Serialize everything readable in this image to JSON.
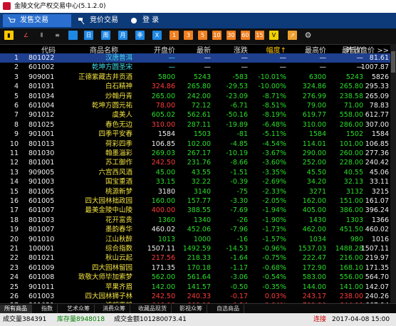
{
  "app": {
    "title": "金陵文化产权交易中心(5.1.2.0)"
  },
  "nav": {
    "tabs": [
      {
        "label": "发售交易"
      },
      {
        "label": "竞价交易"
      },
      {
        "label": "登 录"
      }
    ]
  },
  "toolbar": {
    "buttons": [
      "",
      "",
      "",
      "",
      "",
      "日",
      "周",
      "月",
      "季",
      "X",
      "1",
      "3",
      "5",
      "10",
      "30",
      "60",
      "15",
      "V",
      "",
      ""
    ]
  },
  "table": {
    "headers": [
      "",
      "代码",
      "商品名称",
      "开盘价",
      "最新",
      "涨跌",
      "幅度↑",
      "最高价",
      "最低价",
      "昨收盘价 >>"
    ],
    "rows": [
      [
        "1",
        "801022",
        "汉唐普洱",
        "—",
        "—",
        "—",
        "—",
        "—",
        "—",
        "81.61",
        "cyan",
        "white"
      ],
      [
        "2",
        "601002",
        "乾坤方圆圣宋",
        "—",
        "—",
        "—",
        "—",
        "—",
        "—",
        "1007.87",
        "cyan",
        "white"
      ],
      [
        "3",
        "909001",
        "正德紫藏古井贡酒",
        "5800",
        "5243",
        "-583",
        "-10.01%",
        "6300",
        "5243",
        "5826",
        "green",
        "green"
      ],
      [
        "4",
        "801031",
        "白石精神",
        "324.86",
        "265.80",
        "-29.53",
        "-10.00%",
        "324.86",
        "265.80",
        "295.33",
        "red",
        "green"
      ],
      [
        "5",
        "801034",
        "炒翰丹青",
        "265.00",
        "242.00",
        "-23.09",
        "-8.71%",
        "276.99",
        "238.58",
        "265.09",
        "green",
        "green"
      ],
      [
        "6",
        "601004",
        "乾坤方圆元祐",
        "78.00",
        "72.12",
        "-6.71",
        "-8.51%",
        "79.00",
        "71.00",
        "78.83",
        "red",
        "green"
      ],
      [
        "7",
        "901012",
        "虞美人",
        "605.02",
        "562.61",
        "-50.16",
        "-8.19%",
        "619.77",
        "558.00",
        "612.77",
        "green",
        "green"
      ],
      [
        "8",
        "801025",
        "春色无边",
        "310.00",
        "287.11",
        "-19.89",
        "-6.48%",
        "310.00",
        "286.00",
        "307.00",
        "red",
        "green"
      ],
      [
        "9",
        "901001",
        "四季平安春",
        "1584",
        "1503",
        "-81",
        "-5.11%",
        "1584",
        "1502",
        "1584",
        "white",
        "green"
      ],
      [
        "10",
        "801013",
        "荷彩四季",
        "106.85",
        "102.00",
        "-4.85",
        "-4.54%",
        "114.01",
        "101.00",
        "106.85",
        "white",
        "green"
      ],
      [
        "11",
        "801030",
        "翰墨淄彩",
        "269.03",
        "267.17",
        "-10.19",
        "-3.67%",
        "290.00",
        "260.00",
        "277.36",
        "green",
        "green"
      ],
      [
        "12",
        "801001",
        "苏工御作",
        "242.50",
        "231.76",
        "-8.66",
        "-3.60%",
        "252.00",
        "228.00",
        "240.42",
        "red",
        "green"
      ],
      [
        "13",
        "909005",
        "六宫西风酒",
        "45.00",
        "43.55",
        "-1.51",
        "-3.35%",
        "45.50",
        "40.55",
        "45.06",
        "green",
        "green"
      ],
      [
        "14",
        "901003",
        "国宝重酒",
        "33.15",
        "32.22",
        "-0.39",
        "-2.69%",
        "34.20",
        "32.13",
        "33.11",
        "green",
        "green"
      ],
      [
        "15",
        "801005",
        "桃源新梦",
        "3180",
        "3140",
        "-75",
        "-2.33%",
        "3271",
        "3132",
        "3215",
        "white",
        "green"
      ],
      [
        "16",
        "601005",
        "四大园林拙政园",
        "160.00",
        "157.77",
        "-3.30",
        "-2.05%",
        "162.00",
        "151.00",
        "161.07",
        "green",
        "green"
      ],
      [
        "17",
        "601007",
        "最美金陵中山陵",
        "400.00",
        "388.55",
        "-7.69",
        "-1.94%",
        "405.00",
        "386.00",
        "396.24",
        "red",
        "green"
      ],
      [
        "18",
        "801003",
        "花开富贵",
        "1360",
        "1340",
        "-26",
        "-1.90%",
        "1430",
        "1303",
        "1366",
        "green",
        "green"
      ],
      [
        "19",
        "801007",
        "墨韵春华",
        "460.02",
        "452.06",
        "-7.96",
        "-1.73%",
        "462.00",
        "451.50",
        "460.02",
        "white",
        "green"
      ],
      [
        "20",
        "901010",
        "江山秋醉",
        "1013",
        "1000",
        "-16",
        "-1.57%",
        "1034",
        "980",
        "1016",
        "green",
        "green"
      ],
      [
        "21",
        "100001",
        "综合指数",
        "1507.11",
        "1492.59",
        "-14.53",
        "-0.96%",
        "1537.03",
        "1488.28",
        "1507.11",
        "white",
        "green"
      ],
      [
        "22",
        "801021",
        "秋山云起",
        "217.56",
        "218.33",
        "-1.64",
        "-0.75%",
        "222.47",
        "216.00",
        "219.97",
        "red",
        "green"
      ],
      [
        "23",
        "601009",
        "四大园林留园",
        "171.35",
        "170.18",
        "-1.17",
        "-0.68%",
        "172.90",
        "168.10",
        "171.35",
        "white",
        "green"
      ],
      [
        "24",
        "601008",
        "致敬大师毕加索梦",
        "562.00",
        "561.64",
        "-3.06",
        "-0.54%",
        "583.00",
        "556.00",
        "564.70",
        "green",
        "green"
      ],
      [
        "25",
        "901011",
        "苹果齐眉",
        "142.00",
        "141.57",
        "-0.50",
        "-0.35%",
        "144.00",
        "141.00",
        "142.07",
        "green",
        "green"
      ],
      [
        "26",
        "601003",
        "四大园林狮子林",
        "242.50",
        "240.33",
        "-0.17",
        "0.03%",
        "243.17",
        "238.00",
        "240.26",
        "red",
        "red"
      ],
      [
        "27",
        "801021",
        "鸿朗嘉鹤",
        "646.00",
        "668.18",
        "+0.24",
        "0.04%",
        "709.90",
        "644.00",
        "667.94",
        "red",
        "red"
      ]
    ]
  },
  "bottom_tabs": [
    "所有商品",
    "指数",
    "艺术众筹",
    "消费众筹",
    "收藏品现货",
    "影视众筹",
    "自选商品"
  ],
  "status": {
    "volume": "成交量384391",
    "stock": "库存量8948018",
    "amount": "成交金额101280073.41",
    "conn": "连接",
    "time": "2017-04-08 15:00"
  },
  "colors": {
    "accent": "#2a6fcf",
    "nav": "#0d3b7a",
    "up": "#ff3b3b",
    "down": "#2adf2a"
  },
  "icons": [
    "app-logo-icon",
    "cart-icon",
    "gavel-icon",
    "login-icon",
    "settings-icon"
  ]
}
